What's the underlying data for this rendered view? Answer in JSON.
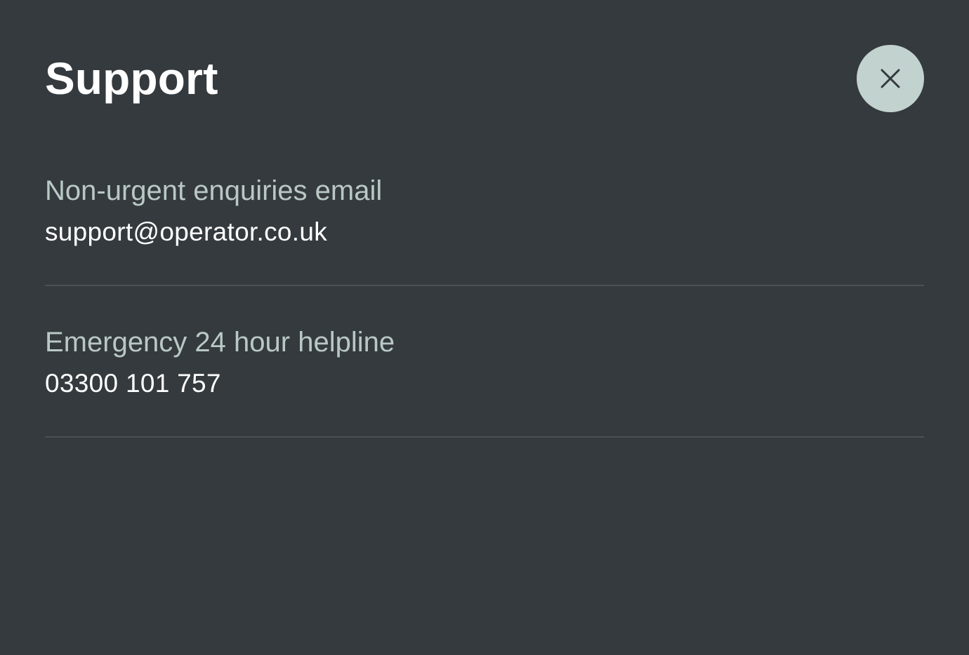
{
  "title": "Support",
  "close_icon": "close-icon",
  "colors": {
    "background": "#343a3e",
    "close_button_bg": "#c2d2cf",
    "label": "#b9c8c5",
    "value": "#ffffff",
    "divider": "#4a5256"
  },
  "sections": [
    {
      "label": "Non-urgent enquiries email",
      "value": "support@operator.co.uk"
    },
    {
      "label": "Emergency 24 hour helpline",
      "value": "03300 101 757"
    }
  ]
}
